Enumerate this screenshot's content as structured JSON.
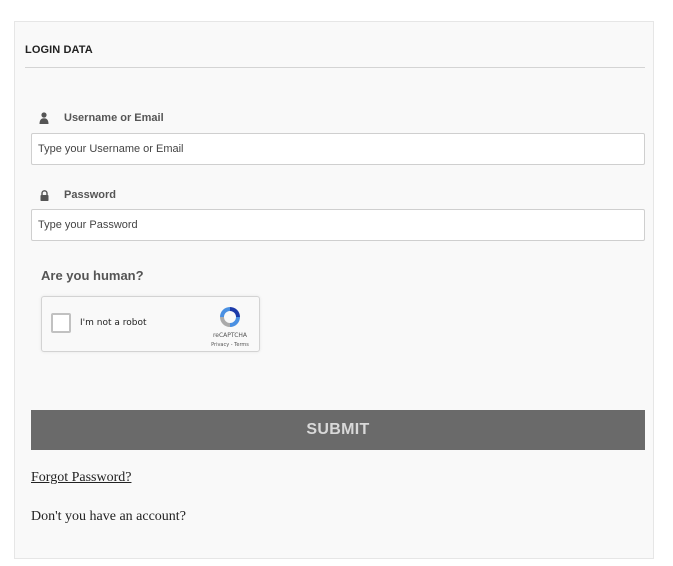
{
  "login": {
    "section_title": "LOGIN DATA",
    "username": {
      "icon": "user-icon",
      "label": "Username or Email",
      "placeholder": "Type your Username or Email"
    },
    "password": {
      "icon": "lock-icon",
      "label": "Password",
      "placeholder": "Type your Password"
    },
    "human_title": "Are you human?",
    "recaptcha": {
      "checkbox_label": "I'm not a robot",
      "brand": "reCAPTCHA",
      "links": "Privacy - Terms",
      "icon": "recaptcha-logo-icon"
    },
    "submit_label": "SUBMIT",
    "forgot_link": "Forgot Password?",
    "no_account_text": "Don't you have an account?"
  },
  "colors": {
    "submit_bg": "#6a6a6a",
    "submit_text": "#d9d9d9",
    "panel_bg": "#f9f9f9"
  }
}
